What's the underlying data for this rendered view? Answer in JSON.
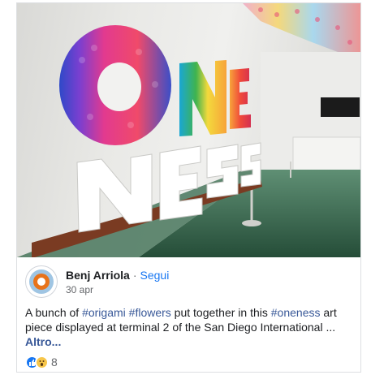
{
  "post": {
    "author": "Benj Arriola",
    "separator": "·",
    "follow_label": "Segui",
    "date": "30 apr",
    "text_parts": {
      "t1": "A bunch of ",
      "h1": "#origami",
      "t2": " ",
      "h2": "#flowers",
      "t3": " put together in this ",
      "h3": "#oneness",
      "t4": " art piece displayed at terminal 2 of the San Diego International ... ",
      "more": "Altro..."
    },
    "reaction_icons": [
      "like-icon",
      "wow-icon"
    ],
    "reaction_count": "8"
  },
  "photo": {
    "letters": [
      "O",
      "N",
      "E",
      "N",
      "E",
      "S",
      "S"
    ],
    "colors": {
      "floor": "#2f5f45",
      "pedestal": "#7a3b22",
      "rainbow": [
        "#2e49c8",
        "#8a3fd0",
        "#e23a8f",
        "#f04a3a",
        "#f7a33a",
        "#f3d93c",
        "#3fb34f",
        "#1aa7d4"
      ]
    }
  }
}
